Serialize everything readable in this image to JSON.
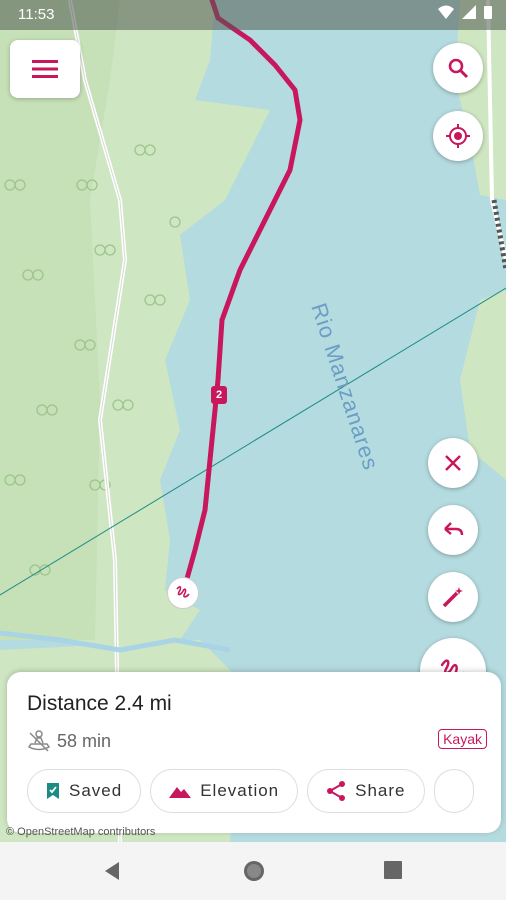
{
  "status_bar": {
    "time": "11:53"
  },
  "map": {
    "river_label": "Rio Manzanares",
    "route_marker": "2",
    "attribution": "© OpenStreetMap contributors"
  },
  "route_panel": {
    "distance": "Distance 2.4 mi",
    "duration": "58 min",
    "activity_badge": "Kayak",
    "buttons": {
      "saved": "Saved",
      "elevation": "Elevation",
      "share": "Share"
    }
  },
  "colors": {
    "accent": "#c8175d",
    "water": "#b4dbe0",
    "land": "#cfe6c2",
    "teal": "#1a8c84"
  },
  "icons": {
    "menu": "menu-icon",
    "search": "search-icon",
    "locate": "gps-locate-icon",
    "close": "close-icon",
    "undo": "undo-icon",
    "magic": "magic-wand-icon",
    "draw": "draw-squiggle-icon",
    "kayak": "kayak-icon",
    "bookmark": "bookmark-check-icon",
    "mountain": "mountain-icon",
    "share": "share-icon"
  }
}
